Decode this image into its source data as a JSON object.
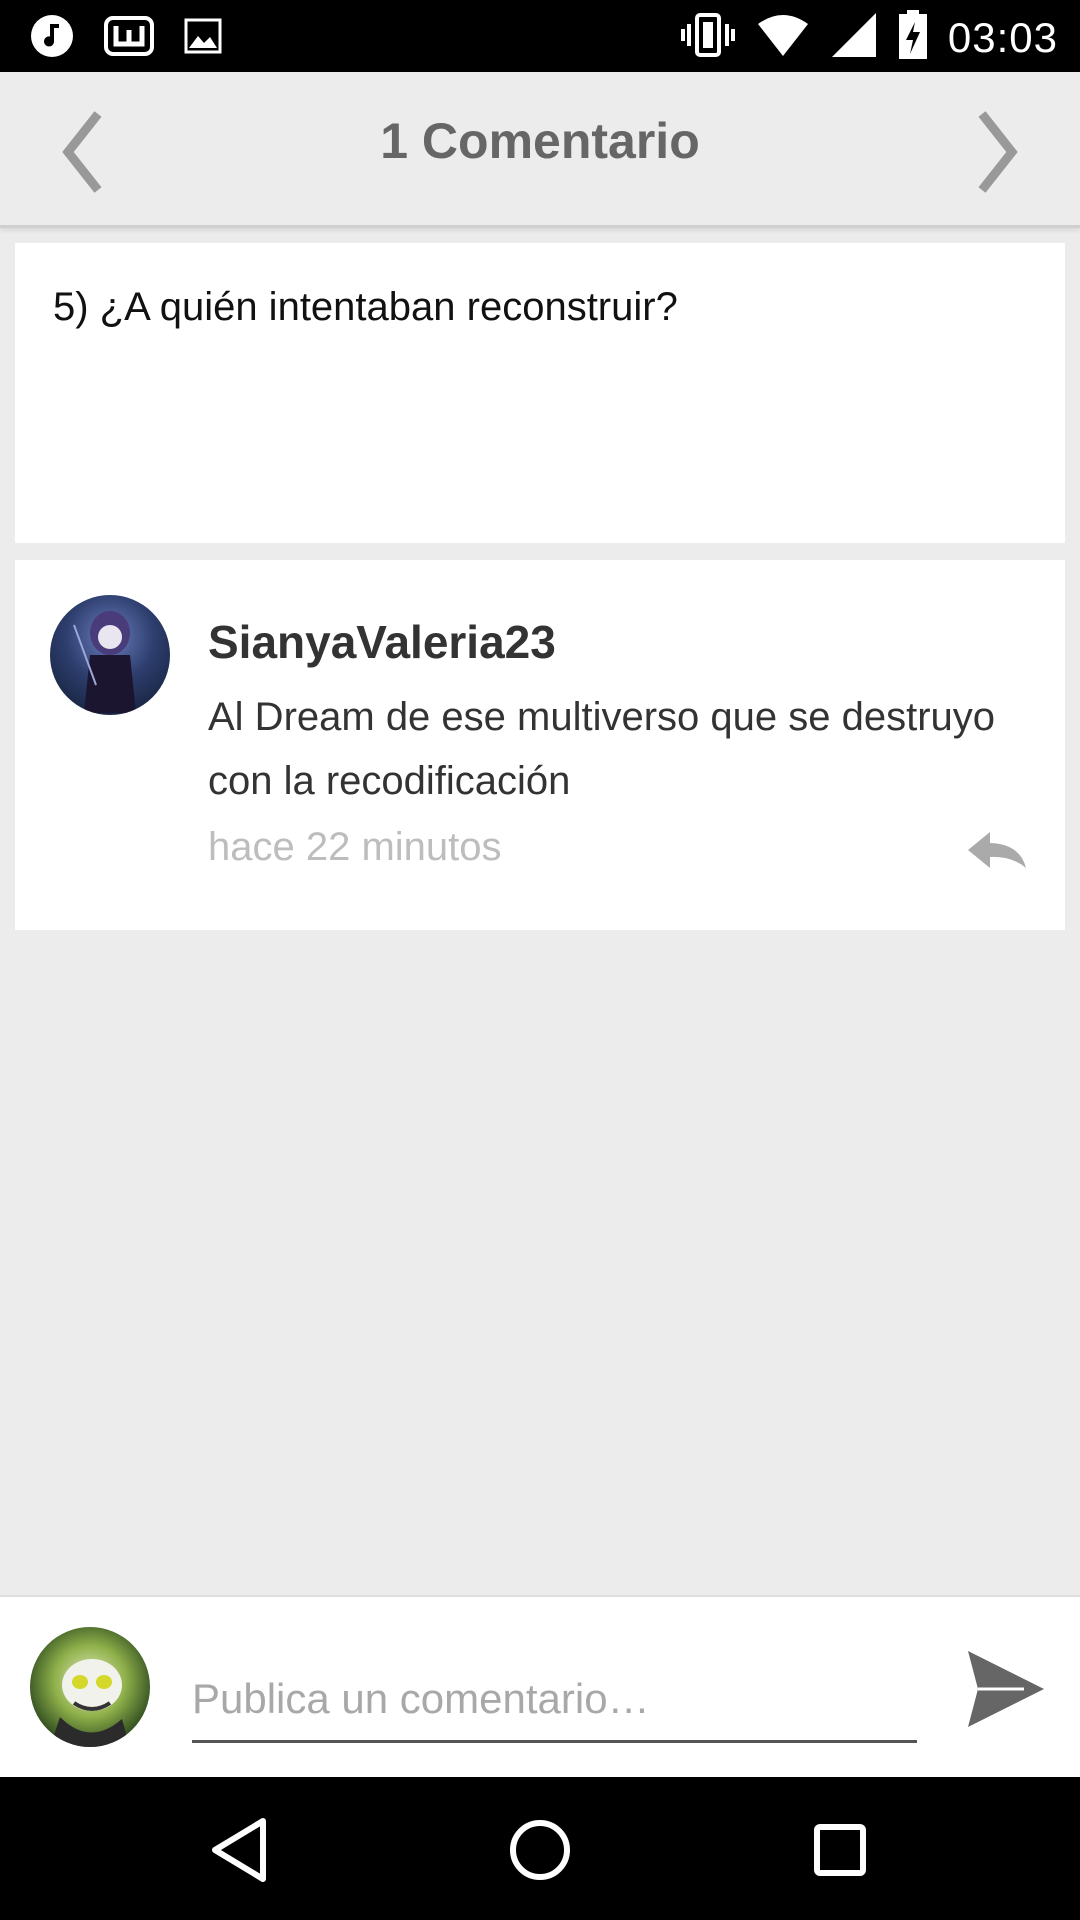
{
  "status_bar": {
    "time": "03:03",
    "left_icons": [
      "music-note-icon",
      "word-app-icon",
      "image-icon"
    ],
    "right_icons": [
      "vibrate-icon",
      "wifi-icon",
      "signal-icon",
      "battery-icon"
    ]
  },
  "header": {
    "title": "1 Comentario",
    "prev_icon": "chevron-left-icon",
    "next_icon": "chevron-right-icon"
  },
  "post": {
    "text": "5) ¿A quién intentaban reconstruir?"
  },
  "comments": [
    {
      "author": "SianyaValeria23",
      "body": "Al Dream de ese multiverso que se destruyo con la recodificación",
      "time": "hace 22 minutos",
      "reply_icon": "reply-icon"
    }
  ],
  "composer": {
    "placeholder": "Publica un comentario…",
    "send_icon": "send-icon"
  },
  "colors": {
    "background": "#ececec",
    "card": "#ffffff",
    "title": "#666666",
    "muted": "#bdbdbd"
  }
}
